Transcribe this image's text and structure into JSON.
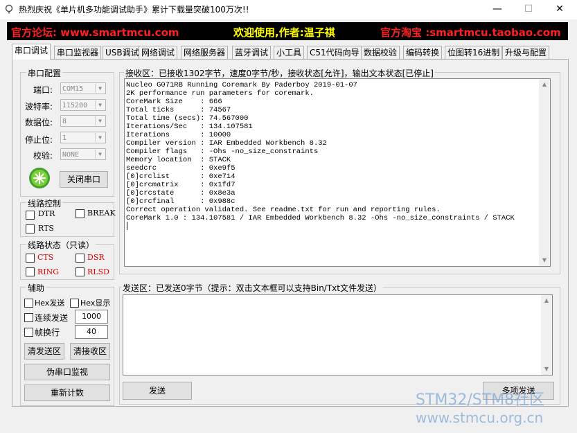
{
  "window": {
    "title": "热烈庆祝《单片机多功能调试助手》累计下载量突破100万次!!",
    "minimize": "—",
    "maximize": "☐",
    "close": "✕"
  },
  "banner": {
    "left": "官方论坛: www.smartmcu.com",
    "center": "欢迎使用,作者:温子祺",
    "right": "官方淘宝 :smartmcu.taobao.com",
    "colors": {
      "left": "#ff2020",
      "center": "#ffff00",
      "right": "#ff2020"
    }
  },
  "tabs": [
    "串口调试",
    "串口监视器",
    "USB调试",
    "网络调试",
    "网络服务器",
    "蓝牙调试",
    "小工具",
    "C51代码向导",
    "数据校验",
    "编码转换",
    "位图转16进制",
    "升级与配置"
  ],
  "serial_config": {
    "title": "串口配置",
    "port_label": "端口:",
    "port_value": "COM15",
    "baud_label": "波特率:",
    "baud_value": "115200",
    "data_label": "数据位:",
    "data_value": "8",
    "stop_label": "停止位:",
    "stop_value": "1",
    "parity_label": "校验:",
    "parity_value": "NONE",
    "close_button": "关闭串口"
  },
  "line_control": {
    "title": "线路控制",
    "dtr": "DTR",
    "break": "BREAK",
    "rts": "RTS"
  },
  "line_status": {
    "title": "线路状态（只读）",
    "cts": "CTS",
    "dsr": "DSR",
    "ring": "RING",
    "rlsd": "RLSD"
  },
  "assist": {
    "title": "辅助",
    "hex_send": "Hex发送",
    "hex_display": "Hex显示",
    "continuous_send": "连续发送",
    "continuous_value": "1000",
    "frame_wrap": "帧换行",
    "frame_value": "40",
    "clear_send": "清发送区",
    "clear_recv": "清接收区",
    "pseudo_monitor": "伪串口监视",
    "recount": "重新计数"
  },
  "receive": {
    "title": "接收区：已接收1302字节，速度0字节/秒，接收状态[允许]，输出文本状态[已停止]",
    "lines": [
      "Nucleo G071RB Running Coremark By Paderboy 2019-01-07",
      "2K performance run parameters for coremark.",
      "CoreMark Size    : 666",
      "Total ticks      : 74567",
      "Total time (secs): 74.567000",
      "Iterations/Sec   : 134.107581",
      "Iterations       : 10000",
      "Compiler version : IAR Embedded Workbench 8.32",
      "Compiler flags   : -Ohs -no_size_constraints",
      "Memory location  : STACK",
      "seedcrc          : 0xe9f5",
      "[0]crclist       : 0xe714",
      "[0]crcmatrix     : 0x1fd7",
      "[0]crcstate      : 0x8e3a",
      "[0]crcfinal      : 0x988c",
      "Correct operation validated. See readme.txt for run and reporting rules.",
      "CoreMark 1.0 : 134.107581 / IAR Embedded Workbench 8.32 -Ohs -no_size_constraints / STACK"
    ]
  },
  "send": {
    "title": "发送区：已发送0字节（提示：双击文本框可以支持Bin/Txt文件发送）",
    "send_button": "发送",
    "multi_send_button": "多项发送"
  },
  "watermark": {
    "line1": "STM32/STM8社区",
    "line2": "www.stmcu.org.cn"
  }
}
